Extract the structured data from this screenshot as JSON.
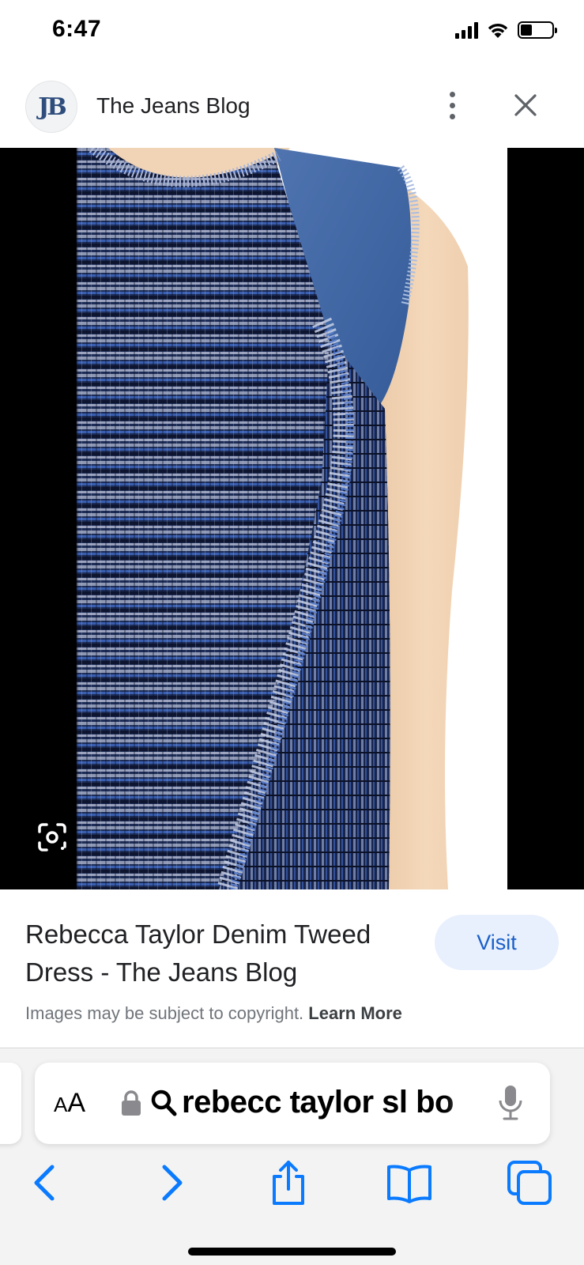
{
  "status_bar": {
    "time": "6:47"
  },
  "header": {
    "logo_text": "JB",
    "site_name": "The Jeans Blog",
    "more_icon": "more-vert-icon",
    "close_icon": "close-icon"
  },
  "image": {
    "lens_icon": "lens-search-icon"
  },
  "caption": {
    "title": "Rebecca Taylor Denim Tweed Dress - The Jeans Blog",
    "visit_label": "Visit",
    "copyright_text": "Images may be subject to copyright.",
    "learn_more": "Learn More"
  },
  "safari": {
    "aa_large": "A",
    "aa_small": "A",
    "url_text": "rebecc taylor sl bo",
    "toolbar_icons": [
      "back-icon",
      "forward-icon",
      "share-icon",
      "bookmarks-icon",
      "tabs-icon"
    ]
  },
  "colors": {
    "accent": "#1a5fc8",
    "visit_bg": "#e8f0fe",
    "safari_blue": "#0a7aff",
    "denim": "#2f4d7c"
  }
}
